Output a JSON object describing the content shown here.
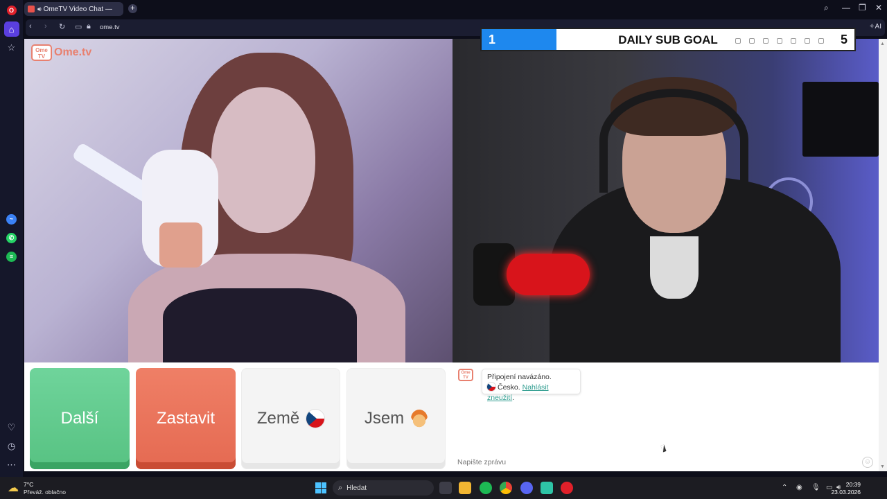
{
  "browser": {
    "tab_title": "OmeTV Video Chat —",
    "new_tab_symbol": "+",
    "url": "ome.tv",
    "ai_label": "AI"
  },
  "site": {
    "logo_box": "Ome TV",
    "logo_text": "Ome.tv"
  },
  "goal": {
    "title": "DAILY SUB GOAL",
    "current": "1",
    "target": "5",
    "progress_fraction": 0.2,
    "bar_color": "#1e88ee"
  },
  "buttons": {
    "next": "Další",
    "stop": "Zastavit",
    "country": "Země",
    "me": "Jsem"
  },
  "chat": {
    "status": "Připojení navázáno.",
    "country": "Česko.",
    "report_link": "Nahlásit zneužití",
    "report_suffix": ".",
    "input_placeholder": "Napište zprávu"
  },
  "taskbar": {
    "weather_temp": "7°C",
    "weather_desc": "Převáž. oblačno",
    "search_label": "Hledat",
    "time": "20:39",
    "date": "23.03.2026"
  },
  "colors": {
    "next_green": "#6fd49b",
    "stop_red": "#e56a52",
    "brand_coral": "#e8806f",
    "link_teal": "#2f9d8f"
  },
  "icons": {
    "sidebar": [
      "opera-logo-icon",
      "home-icon",
      "star-icon",
      "messenger-icon",
      "whatsapp-icon",
      "spotify-icon",
      "heart-icon",
      "history-icon",
      "more-icon"
    ],
    "taskbar": [
      "start-icon",
      "search-icon",
      "file-explorer-icon",
      "spotify-icon",
      "chrome-icon",
      "discord-icon",
      "app-icon",
      "opera-icon"
    ]
  }
}
